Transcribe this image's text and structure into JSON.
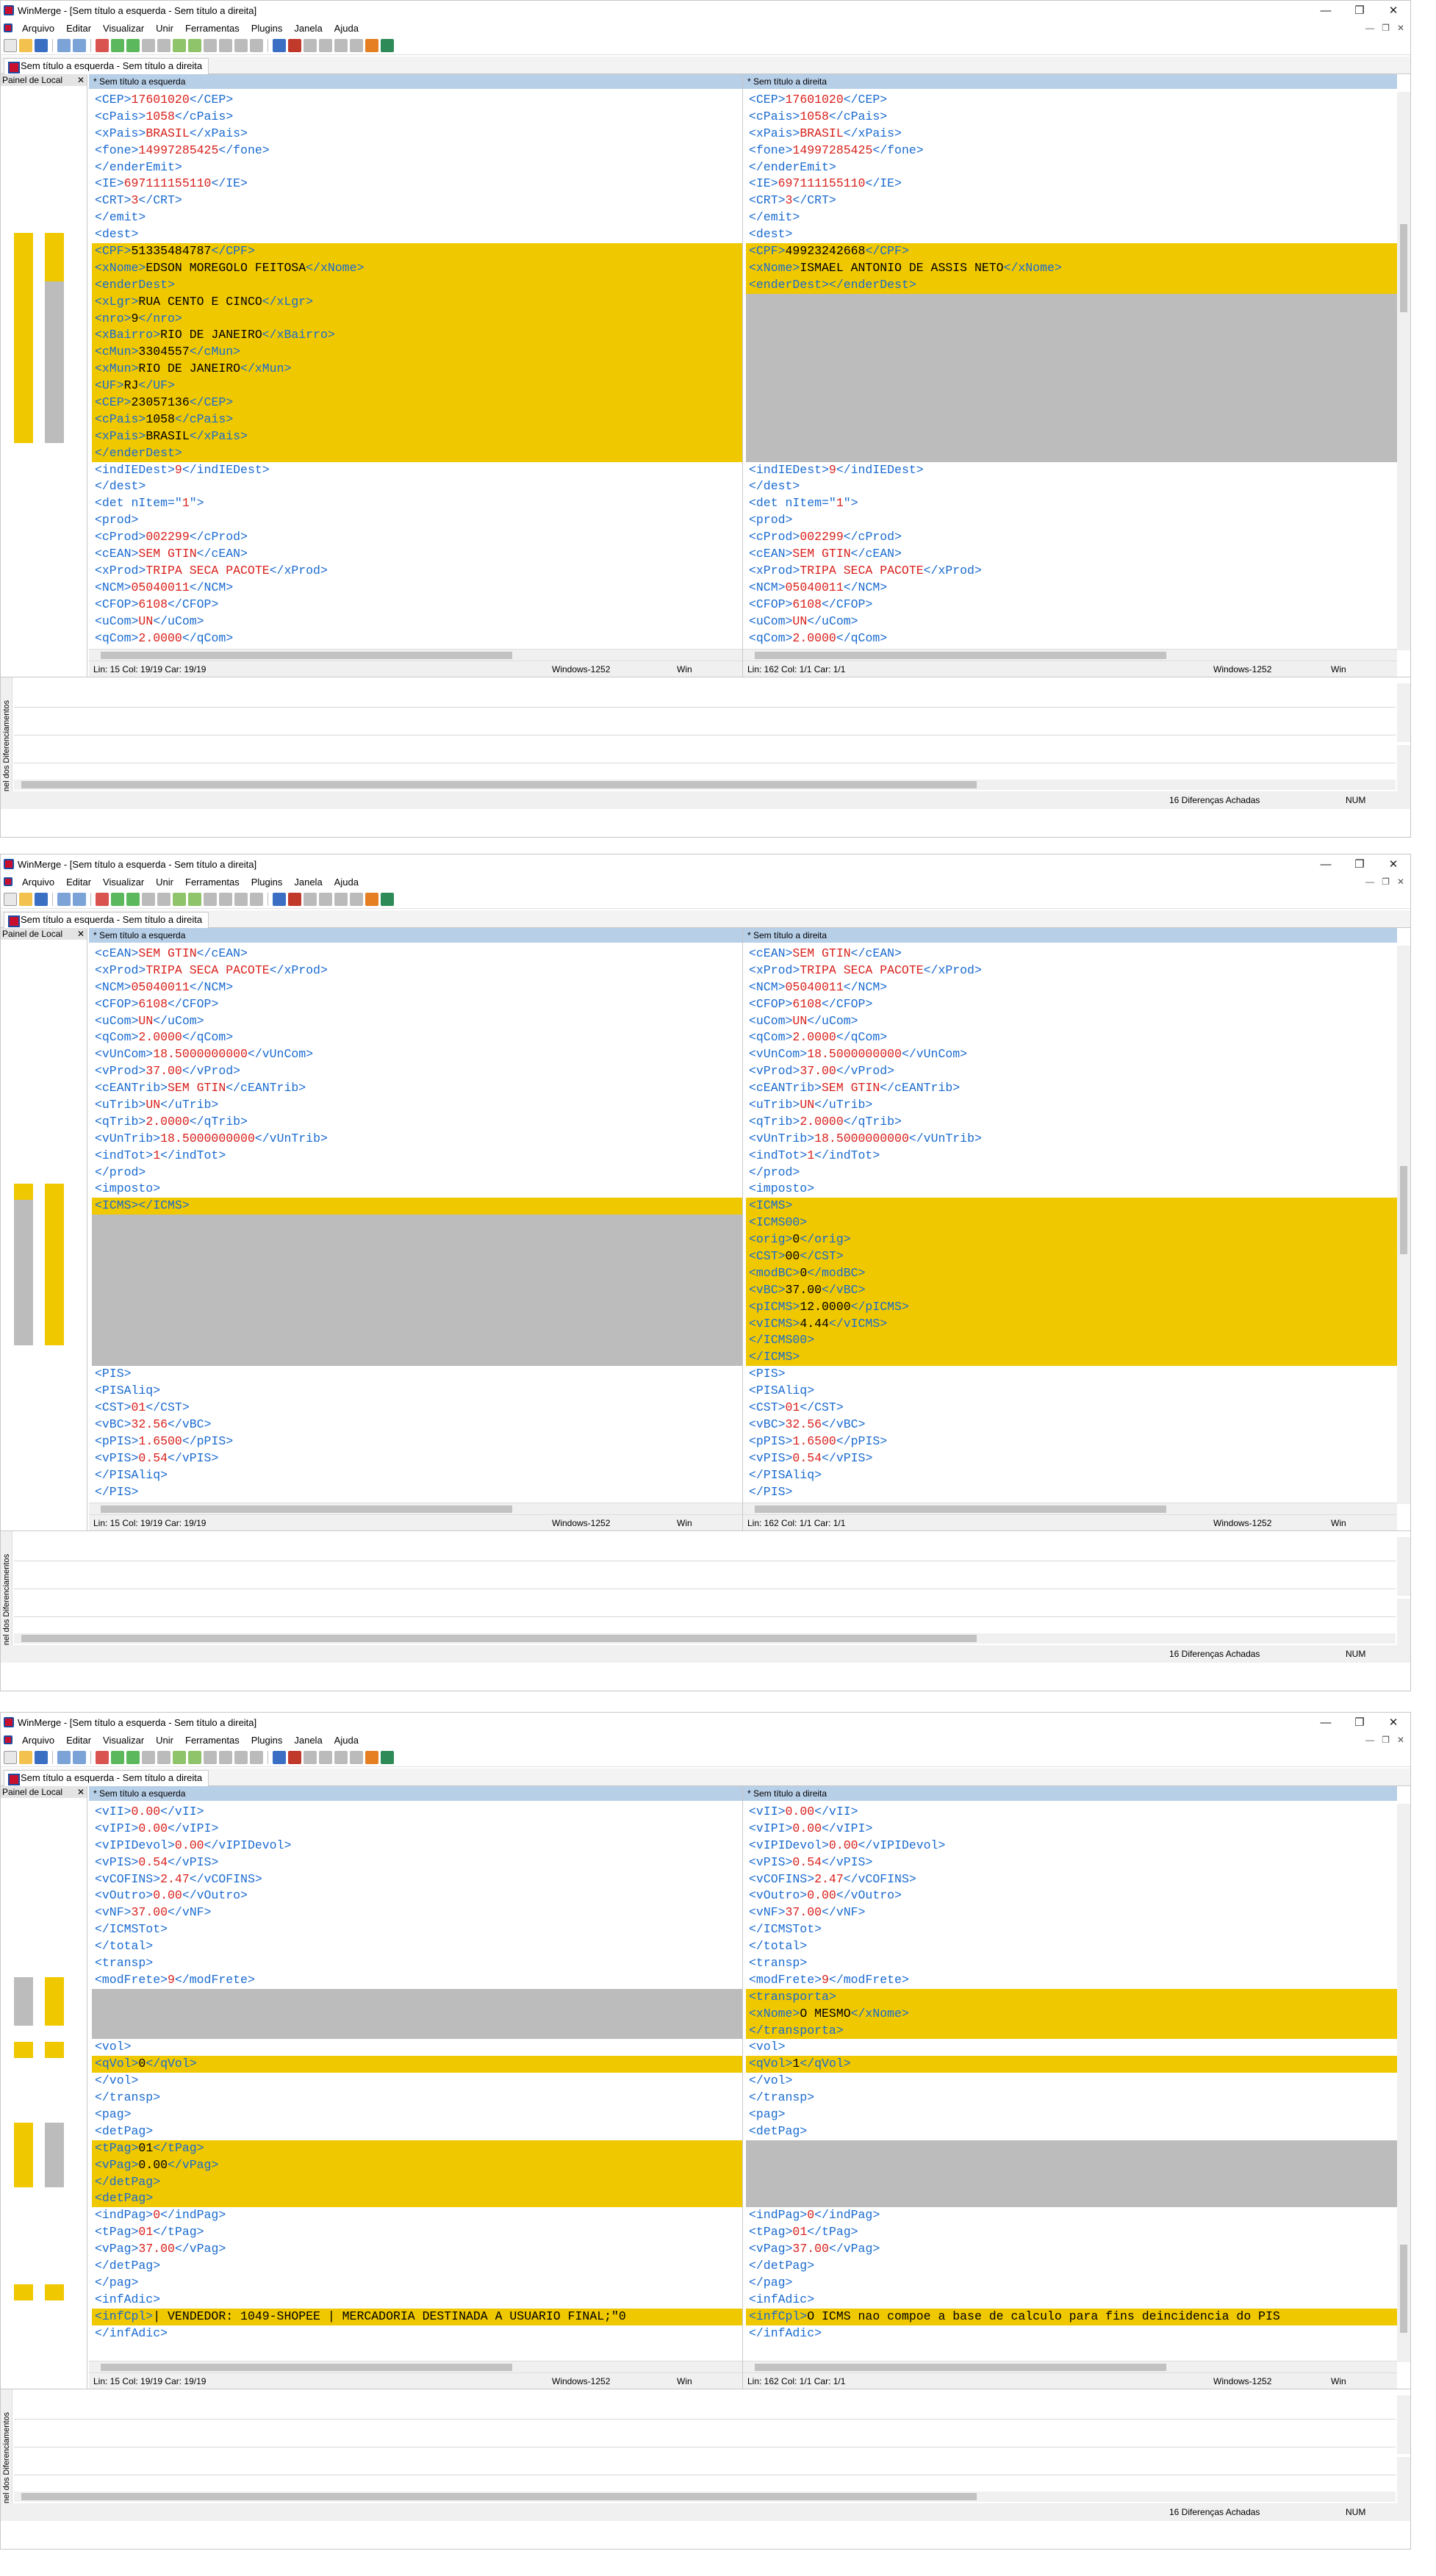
{
  "app_title": "WinMerge - [Sem título a esquerda - Sem título a direita]",
  "menu": [
    "Arquivo",
    "Editar",
    "Visualizar",
    "Unir",
    "Ferramentas",
    "Plugins",
    "Janela",
    "Ajuda"
  ],
  "tab_label": "Sem título a esquerda - Sem título a direita",
  "location_pane_label": "Painel de Local",
  "diff_pane_label": "Painel dos Diferenciamentos",
  "left_header": "* Sem título a esquerda",
  "right_header": "* Sem título a direita",
  "status": {
    "left_pos": "Lin: 15  Col: 19/19  Car: 19/19",
    "right_pos": "Lin: 162  Col: 1/1  Car: 1/1",
    "encoding": "Windows-1252",
    "eol": "Win",
    "diffs_found": "16 Diferenças Achadas",
    "num": "NUM"
  },
  "colors": {
    "diff": "#f0c800",
    "gap": "#bcbcbc",
    "tag": "#1a6bd0",
    "value": "#d8201b",
    "highlight": "#ef9a7a",
    "header": "#b8cfe8"
  },
  "windows": [
    {
      "left": [
        [
          "n",
          "<CEP>",
          "17601020",
          "</CEP>"
        ],
        [
          "n",
          "<cPais>",
          "1058",
          "</cPais>"
        ],
        [
          "n",
          "<xPais>",
          "BRASIL",
          "</xPais>"
        ],
        [
          "n",
          "<fone>",
          "14997285425",
          "</fone>"
        ],
        [
          "n",
          "</enderEmit>",
          "",
          ""
        ],
        [
          "n",
          "<IE>",
          "697111155110",
          "</IE>"
        ],
        [
          "n",
          "<CRT>",
          "3",
          "</CRT>"
        ],
        [
          "n",
          "</emit>",
          "",
          ""
        ],
        [
          "n",
          "<dest>",
          "",
          ""
        ],
        [
          "d",
          "<CPF>",
          "51335484787",
          "</CPF>"
        ],
        [
          "d",
          "<xNome>",
          "EDSON MOREGOLO FEITOSA",
          "</xNome>"
        ],
        [
          "d",
          "<enderDest>",
          "",
          ""
        ],
        [
          "d",
          "<xLgr>",
          "RUA CENTO E CINCO",
          "</xLgr>"
        ],
        [
          "d",
          "<nro>",
          "9",
          "</nro>"
        ],
        [
          "d",
          "<xBairro>",
          "RIO DE JANEIRO",
          "</xBairro>"
        ],
        [
          "d",
          "<cMun>",
          "3304557",
          "</cMun>"
        ],
        [
          "d",
          "<xMun>",
          "RIO DE JANEIRO",
          "</xMun>"
        ],
        [
          "d",
          "<UF>",
          "RJ",
          "</UF>"
        ],
        [
          "d",
          "<CEP>",
          "23057136",
          "</CEP>"
        ],
        [
          "d",
          "<cPais>",
          "1058",
          "</cPais>"
        ],
        [
          "d",
          "<xPais>",
          "BRASIL",
          "</xPais>"
        ],
        [
          "d",
          "</enderDest>",
          "",
          ""
        ],
        [
          "n",
          "<indIEDest>",
          "9",
          "</indIEDest>"
        ],
        [
          "n",
          "</dest>",
          "",
          ""
        ],
        [
          "n",
          "<det nItem=\"",
          "1",
          "\">"
        ],
        [
          "n",
          "<prod>",
          "",
          ""
        ],
        [
          "n",
          "<cProd>",
          "002299",
          "</cProd>"
        ],
        [
          "n",
          "<cEAN>",
          "SEM GTIN",
          "</cEAN>"
        ],
        [
          "n",
          "<xProd>",
          "TRIPA SECA PACOTE",
          "</xProd>"
        ],
        [
          "n",
          "<NCM>",
          "05040011",
          "</NCM>"
        ],
        [
          "n",
          "<CFOP>",
          "6108",
          "</CFOP>"
        ],
        [
          "n",
          "<uCom>",
          "UN",
          "</uCom>"
        ],
        [
          "n",
          "<qCom>",
          "2.0000",
          "</qCom>"
        ]
      ],
      "right": [
        [
          "n",
          "<CEP>",
          "17601020",
          "</CEP>"
        ],
        [
          "n",
          "<cPais>",
          "1058",
          "</cPais>"
        ],
        [
          "n",
          "<xPais>",
          "BRASIL",
          "</xPais>"
        ],
        [
          "n",
          "<fone>",
          "14997285425",
          "</fone>"
        ],
        [
          "n",
          "</enderEmit>",
          "",
          ""
        ],
        [
          "n",
          "<IE>",
          "697111155110",
          "</IE>"
        ],
        [
          "n",
          "<CRT>",
          "3",
          "</CRT>"
        ],
        [
          "n",
          "</emit>",
          "",
          ""
        ],
        [
          "n",
          "<dest>",
          "",
          ""
        ],
        [
          "d",
          "<CPF>",
          "49923242668",
          "</CPF>"
        ],
        [
          "d",
          "<xNome>",
          "ISMAEL ANTONIO DE ASSIS NETO",
          "</xNome>"
        ],
        [
          "d",
          "<enderDest>",
          "",
          "</enderDest>"
        ],
        [
          "g",
          "",
          "",
          ""
        ],
        [
          "g",
          "",
          "",
          ""
        ],
        [
          "g",
          "",
          "",
          ""
        ],
        [
          "g",
          "",
          "",
          ""
        ],
        [
          "g",
          "",
          "",
          ""
        ],
        [
          "g",
          "",
          "",
          ""
        ],
        [
          "g",
          "",
          "",
          ""
        ],
        [
          "g",
          "",
          "",
          ""
        ],
        [
          "g",
          "",
          "",
          ""
        ],
        [
          "g",
          "",
          "",
          ""
        ],
        [
          "n",
          "<indIEDest>",
          "9",
          "</indIEDest>"
        ],
        [
          "n",
          "</dest>",
          "",
          ""
        ],
        [
          "n",
          "<det nItem=\"",
          "1",
          "\">"
        ],
        [
          "n",
          "<prod>",
          "",
          ""
        ],
        [
          "n",
          "<cProd>",
          "002299",
          "</cProd>"
        ],
        [
          "n",
          "<cEAN>",
          "SEM GTIN",
          "</cEAN>"
        ],
        [
          "n",
          "<xProd>",
          "TRIPA SECA PACOTE",
          "</xProd>"
        ],
        [
          "n",
          "<NCM>",
          "05040011",
          "</NCM>"
        ],
        [
          "n",
          "<CFOP>",
          "6108",
          "</CFOP>"
        ],
        [
          "n",
          "<uCom>",
          "UN",
          "</uCom>"
        ],
        [
          "n",
          "<qCom>",
          "2.0000",
          "</qCom>"
        ]
      ]
    },
    {
      "left": [
        [
          "n",
          "<cEAN>",
          "SEM GTIN",
          "</cEAN>"
        ],
        [
          "n",
          "<xProd>",
          "TRIPA SECA PACOTE",
          "</xProd>"
        ],
        [
          "n",
          "<NCM>",
          "05040011",
          "</NCM>"
        ],
        [
          "n",
          "<CFOP>",
          "6108",
          "</CFOP>"
        ],
        [
          "n",
          "<uCom>",
          "UN",
          "</uCom>"
        ],
        [
          "n",
          "<qCom>",
          "2.0000",
          "</qCom>"
        ],
        [
          "n",
          "<vUnCom>",
          "18.5000000000",
          "</vUnCom>"
        ],
        [
          "n",
          "<vProd>",
          "37.00",
          "</vProd>"
        ],
        [
          "n",
          "<cEANTrib>",
          "SEM GTIN",
          "</cEANTrib>"
        ],
        [
          "n",
          "<uTrib>",
          "UN",
          "</uTrib>"
        ],
        [
          "n",
          "<qTrib>",
          "2.0000",
          "</qTrib>"
        ],
        [
          "n",
          "<vUnTrib>",
          "18.5000000000",
          "</vUnTrib>"
        ],
        [
          "n",
          "<indTot>",
          "1",
          "</indTot>"
        ],
        [
          "n",
          "</prod>",
          "",
          ""
        ],
        [
          "n",
          "<imposto>",
          "",
          ""
        ],
        [
          "d",
          "<ICMS></ICMS>",
          "",
          ""
        ],
        [
          "g",
          "",
          "",
          ""
        ],
        [
          "g",
          "",
          "",
          ""
        ],
        [
          "g",
          "",
          "",
          ""
        ],
        [
          "g",
          "",
          "",
          ""
        ],
        [
          "g",
          "",
          "",
          ""
        ],
        [
          "g",
          "",
          "",
          ""
        ],
        [
          "g",
          "",
          "",
          ""
        ],
        [
          "g",
          "",
          "",
          ""
        ],
        [
          "g",
          "",
          "",
          ""
        ],
        [
          "n",
          "<PIS>",
          "",
          ""
        ],
        [
          "n",
          "<PISAliq>",
          "",
          ""
        ],
        [
          "n",
          "<CST>",
          "01",
          "</CST>"
        ],
        [
          "n",
          "<vBC>",
          "32.56",
          "</vBC>"
        ],
        [
          "n",
          "<pPIS>",
          "1.6500",
          "</pPIS>"
        ],
        [
          "n",
          "<vPIS>",
          "0.54",
          "</vPIS>"
        ],
        [
          "n",
          "</PISAliq>",
          "",
          ""
        ],
        [
          "n",
          "</PIS>",
          "",
          ""
        ]
      ],
      "right": [
        [
          "n",
          "<cEAN>",
          "SEM GTIN",
          "</cEAN>"
        ],
        [
          "n",
          "<xProd>",
          "TRIPA SECA PACOTE",
          "</xProd>"
        ],
        [
          "n",
          "<NCM>",
          "05040011",
          "</NCM>"
        ],
        [
          "n",
          "<CFOP>",
          "6108",
          "</CFOP>"
        ],
        [
          "n",
          "<uCom>",
          "UN",
          "</uCom>"
        ],
        [
          "n",
          "<qCom>",
          "2.0000",
          "</qCom>"
        ],
        [
          "n",
          "<vUnCom>",
          "18.5000000000",
          "</vUnCom>"
        ],
        [
          "n",
          "<vProd>",
          "37.00",
          "</vProd>"
        ],
        [
          "n",
          "<cEANTrib>",
          "SEM GTIN",
          "</cEANTrib>"
        ],
        [
          "n",
          "<uTrib>",
          "UN",
          "</uTrib>"
        ],
        [
          "n",
          "<qTrib>",
          "2.0000",
          "</qTrib>"
        ],
        [
          "n",
          "<vUnTrib>",
          "18.5000000000",
          "</vUnTrib>"
        ],
        [
          "n",
          "<indTot>",
          "1",
          "</indTot>"
        ],
        [
          "n",
          "</prod>",
          "",
          ""
        ],
        [
          "n",
          "<imposto>",
          "",
          ""
        ],
        [
          "d",
          "<ICMS>",
          "",
          ""
        ],
        [
          "d",
          "<ICMS00>",
          "",
          ""
        ],
        [
          "d",
          "<orig>",
          "0",
          "</orig>"
        ],
        [
          "d",
          "<CST>",
          "00",
          "</CST>"
        ],
        [
          "d",
          "<modBC>",
          "0",
          "</modBC>"
        ],
        [
          "d",
          "<vBC>",
          "37.00",
          "</vBC>"
        ],
        [
          "d",
          "<pICMS>",
          "12.0000",
          "</pICMS>"
        ],
        [
          "d",
          "<vICMS>",
          "4.44",
          "</vICMS>"
        ],
        [
          "d",
          "</ICMS00>",
          "",
          ""
        ],
        [
          "d",
          "</ICMS>",
          "",
          ""
        ],
        [
          "n",
          "<PIS>",
          "",
          ""
        ],
        [
          "n",
          "<PISAliq>",
          "",
          ""
        ],
        [
          "n",
          "<CST>",
          "01",
          "</CST>"
        ],
        [
          "n",
          "<vBC>",
          "32.56",
          "</vBC>"
        ],
        [
          "n",
          "<pPIS>",
          "1.6500",
          "</pPIS>"
        ],
        [
          "n",
          "<vPIS>",
          "0.54",
          "</vPIS>"
        ],
        [
          "n",
          "</PISAliq>",
          "",
          ""
        ],
        [
          "n",
          "</PIS>",
          "",
          ""
        ]
      ]
    },
    {
      "left": [
        [
          "n",
          "<vII>",
          "0.00",
          "</vII>"
        ],
        [
          "n",
          "<vIPI>",
          "0.00",
          "</vIPI>"
        ],
        [
          "n",
          "<vIPIDevol>",
          "0.00",
          "</vIPIDevol>"
        ],
        [
          "n",
          "<vPIS>",
          "0.54",
          "</vPIS>"
        ],
        [
          "n",
          "<vCOFINS>",
          "2.47",
          "</vCOFINS>"
        ],
        [
          "n",
          "<vOutro>",
          "0.00",
          "</vOutro>"
        ],
        [
          "n",
          "<vNF>",
          "37.00",
          "</vNF>"
        ],
        [
          "n",
          "</ICMSTot>",
          "",
          ""
        ],
        [
          "n",
          "</total>",
          "",
          ""
        ],
        [
          "n",
          "<transp>",
          "",
          ""
        ],
        [
          "n",
          "<modFrete>",
          "9",
          "</modFrete>"
        ],
        [
          "g",
          "",
          "",
          ""
        ],
        [
          "g",
          "",
          "",
          ""
        ],
        [
          "g",
          "",
          "",
          ""
        ],
        [
          "n",
          "<vol>",
          "",
          ""
        ],
        [
          "d",
          "<qVol>",
          "0",
          "</qVol>"
        ],
        [
          "n",
          "</vol>",
          "",
          ""
        ],
        [
          "n",
          "</transp>",
          "",
          ""
        ],
        [
          "n",
          "<pag>",
          "",
          ""
        ],
        [
          "n",
          "<detPag>",
          "",
          ""
        ],
        [
          "d",
          "<tPag>",
          "01",
          "</tPag>"
        ],
        [
          "d",
          "<vPag>",
          "0.00",
          "</vPag>"
        ],
        [
          "d",
          "</detPag>",
          "",
          ""
        ],
        [
          "d",
          "<detPag>",
          "",
          ""
        ],
        [
          "n",
          "<indPag>",
          "0",
          "</indPag>"
        ],
        [
          "n",
          "<tPag>",
          "01",
          "</tPag>"
        ],
        [
          "n",
          "<vPag>",
          "37.00",
          "</vPag>"
        ],
        [
          "n",
          "</detPag>",
          "",
          ""
        ],
        [
          "n",
          "</pag>",
          "",
          ""
        ],
        [
          "n",
          "<infAdic>",
          "",
          ""
        ],
        [
          "d",
          "<infCpl>",
          "| VENDEDOR: 1049-SHOPEE | MERCADORIA DESTINADA A USUARIO FINAL;\"0",
          ""
        ],
        [
          "n",
          "</infAdic>",
          "",
          ""
        ]
      ],
      "right": [
        [
          "n",
          "<vII>",
          "0.00",
          "</vII>"
        ],
        [
          "n",
          "<vIPI>",
          "0.00",
          "</vIPI>"
        ],
        [
          "n",
          "<vIPIDevol>",
          "0.00",
          "</vIPIDevol>"
        ],
        [
          "n",
          "<vPIS>",
          "0.54",
          "</vPIS>"
        ],
        [
          "n",
          "<vCOFINS>",
          "2.47",
          "</vCOFINS>"
        ],
        [
          "n",
          "<vOutro>",
          "0.00",
          "</vOutro>"
        ],
        [
          "n",
          "<vNF>",
          "37.00",
          "</vNF>"
        ],
        [
          "n",
          "</ICMSTot>",
          "",
          ""
        ],
        [
          "n",
          "</total>",
          "",
          ""
        ],
        [
          "n",
          "<transp>",
          "",
          ""
        ],
        [
          "n",
          "<modFrete>",
          "9",
          "</modFrete>"
        ],
        [
          "d",
          "<transporta>",
          "",
          ""
        ],
        [
          "d",
          "<xNome>",
          "O MESMO",
          "</xNome>"
        ],
        [
          "d",
          "</transporta>",
          "",
          ""
        ],
        [
          "n",
          "<vol>",
          "",
          ""
        ],
        [
          "d",
          "<qVol>",
          "1",
          "</qVol>"
        ],
        [
          "n",
          "</vol>",
          "",
          ""
        ],
        [
          "n",
          "</transp>",
          "",
          ""
        ],
        [
          "n",
          "<pag>",
          "",
          ""
        ],
        [
          "n",
          "<detPag>",
          "",
          ""
        ],
        [
          "g",
          "",
          "",
          ""
        ],
        [
          "g",
          "",
          "",
          ""
        ],
        [
          "g",
          "",
          "",
          ""
        ],
        [
          "g",
          "",
          "",
          ""
        ],
        [
          "n",
          "<indPag>",
          "0",
          "</indPag>"
        ],
        [
          "n",
          "<tPag>",
          "01",
          "</tPag>"
        ],
        [
          "n",
          "<vPag>",
          "37.00",
          "</vPag>"
        ],
        [
          "n",
          "</detPag>",
          "",
          ""
        ],
        [
          "n",
          "</pag>",
          "",
          ""
        ],
        [
          "n",
          "<infAdic>",
          "",
          ""
        ],
        [
          "d",
          "<infCpl>",
          "O ICMS nao compoe a base de calculo para fins deincidencia do PIS",
          ""
        ],
        [
          "n",
          "</infAdic>",
          "",
          ""
        ]
      ]
    }
  ]
}
